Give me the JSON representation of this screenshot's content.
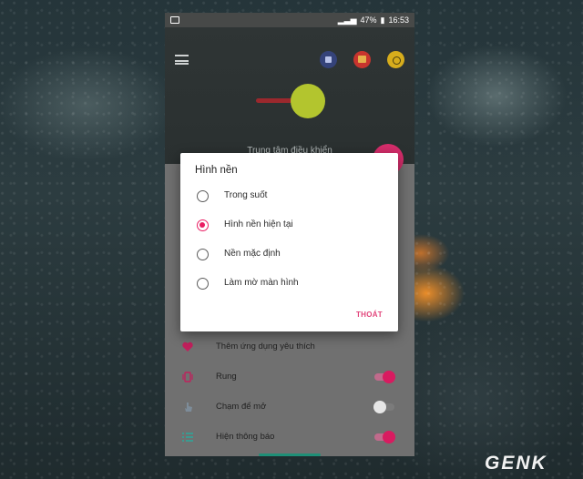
{
  "status_bar": {
    "battery": "47%",
    "time": "16:53"
  },
  "header": {
    "subtitle": "Trung tâm điều khiển"
  },
  "dialog": {
    "title": "Hình nền",
    "options": [
      {
        "label": "Trong suốt",
        "selected": false
      },
      {
        "label": "Hình nền hiện tại",
        "selected": true
      },
      {
        "label": "Nền mặc định",
        "selected": false
      },
      {
        "label": "Làm mờ màn hình",
        "selected": false
      }
    ],
    "exit_label": "THOÁT"
  },
  "settings": [
    {
      "label": "Thêm ứng dụng yêu thích",
      "icon": "heart-icon",
      "toggle": null
    },
    {
      "label": "Rung",
      "icon": "vibrate-icon",
      "toggle": true
    },
    {
      "label": "Chạm để mở",
      "icon": "touch-icon",
      "toggle": false
    },
    {
      "label": "Hiện thông báo",
      "icon": "list-icon",
      "toggle": true
    }
  ],
  "watermark": "GENK",
  "colors": {
    "accent": "#e91e63",
    "header": "#2f3535",
    "fab": "#d62d6b"
  }
}
